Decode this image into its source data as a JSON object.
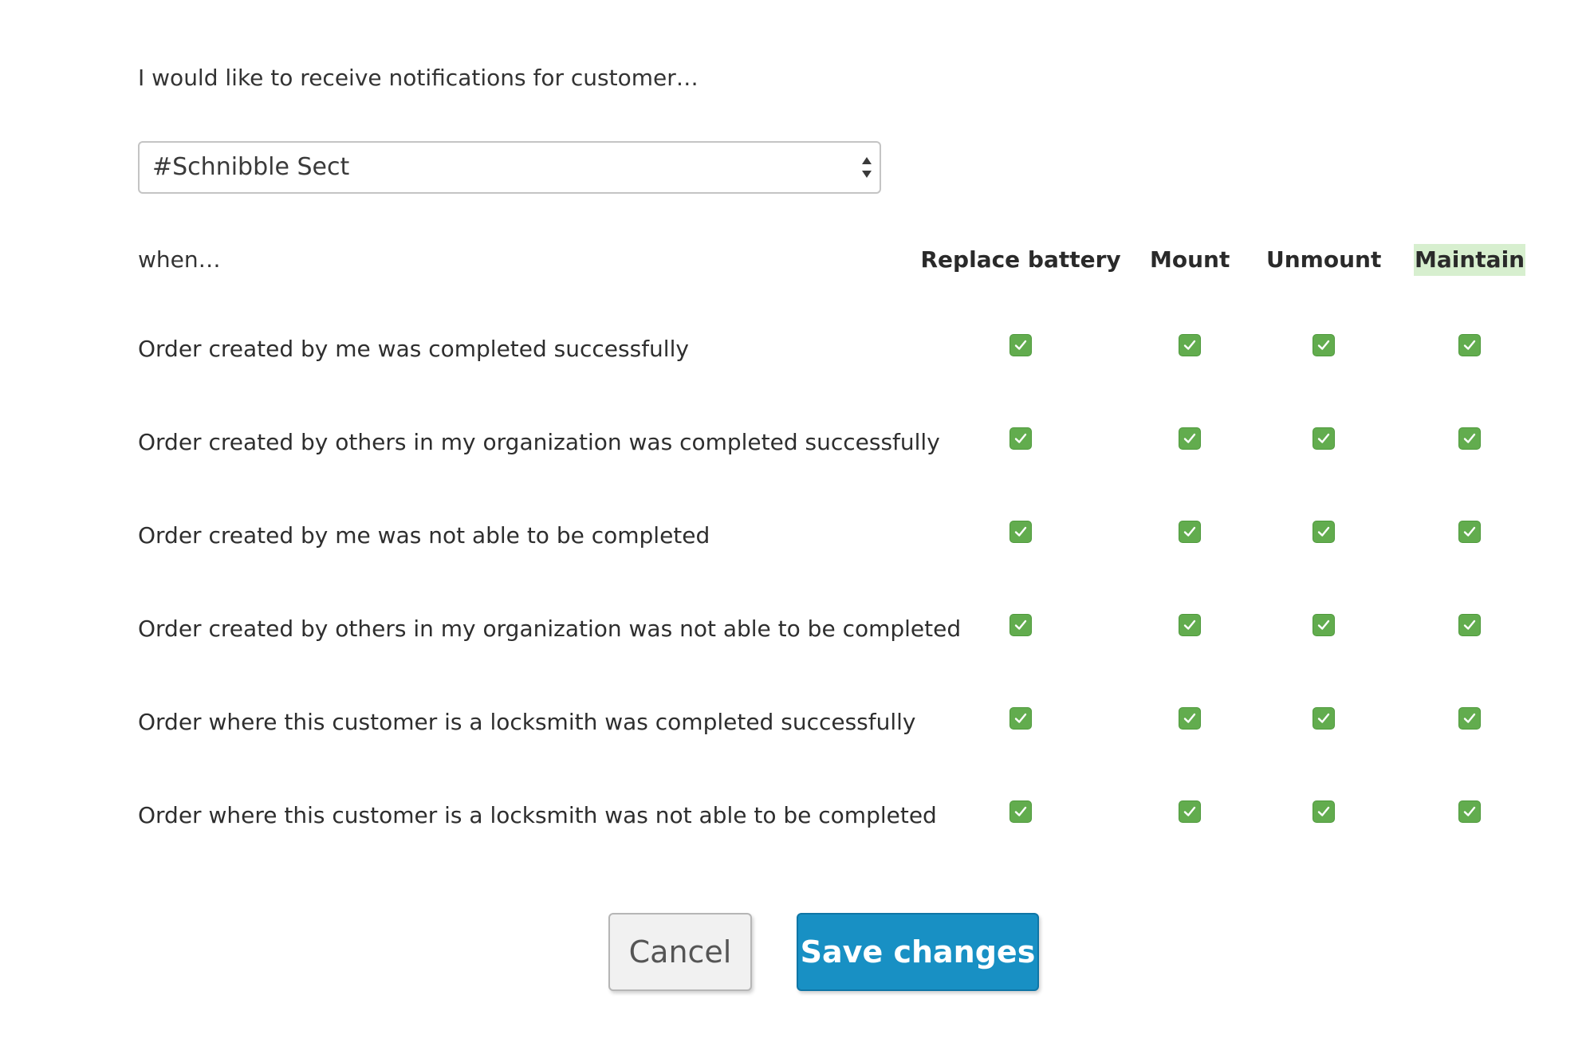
{
  "intro_text": "I would like to receive notifications for customer…",
  "customer_select": {
    "selected_value": "#Schnibble Sect"
  },
  "when_label": "when…",
  "columns": [
    {
      "label": "Replace battery"
    },
    {
      "label": "Mount"
    },
    {
      "label": "Unmount"
    },
    {
      "label": "Maintain",
      "highlighted": true
    }
  ],
  "rows": [
    {
      "label": "Order created by me was completed successfully",
      "checked": [
        true,
        true,
        true,
        true
      ]
    },
    {
      "label": "Order created by others in my organization was completed successfully",
      "checked": [
        true,
        true,
        true,
        true
      ]
    },
    {
      "label": "Order created by me was not able to be completed",
      "checked": [
        true,
        true,
        true,
        true
      ]
    },
    {
      "label": "Order created by others in my organization was not able to be completed",
      "checked": [
        true,
        true,
        true,
        true
      ]
    },
    {
      "label": "Order where this customer is a locksmith was completed successfully",
      "checked": [
        true,
        true,
        true,
        true
      ]
    },
    {
      "label": "Order where this customer is a locksmith was not able to be completed",
      "checked": [
        true,
        true,
        true,
        true
      ]
    }
  ],
  "buttons": {
    "cancel_label": "Cancel",
    "save_label": "Save changes"
  },
  "colors": {
    "checkbox_green": "#62ac4e",
    "save_button_blue": "#1890c4",
    "header_highlight": "#d7efcf"
  },
  "icons": {
    "select_arrows": "up-down-arrows-icon",
    "checkbox": "checkmark-icon"
  }
}
